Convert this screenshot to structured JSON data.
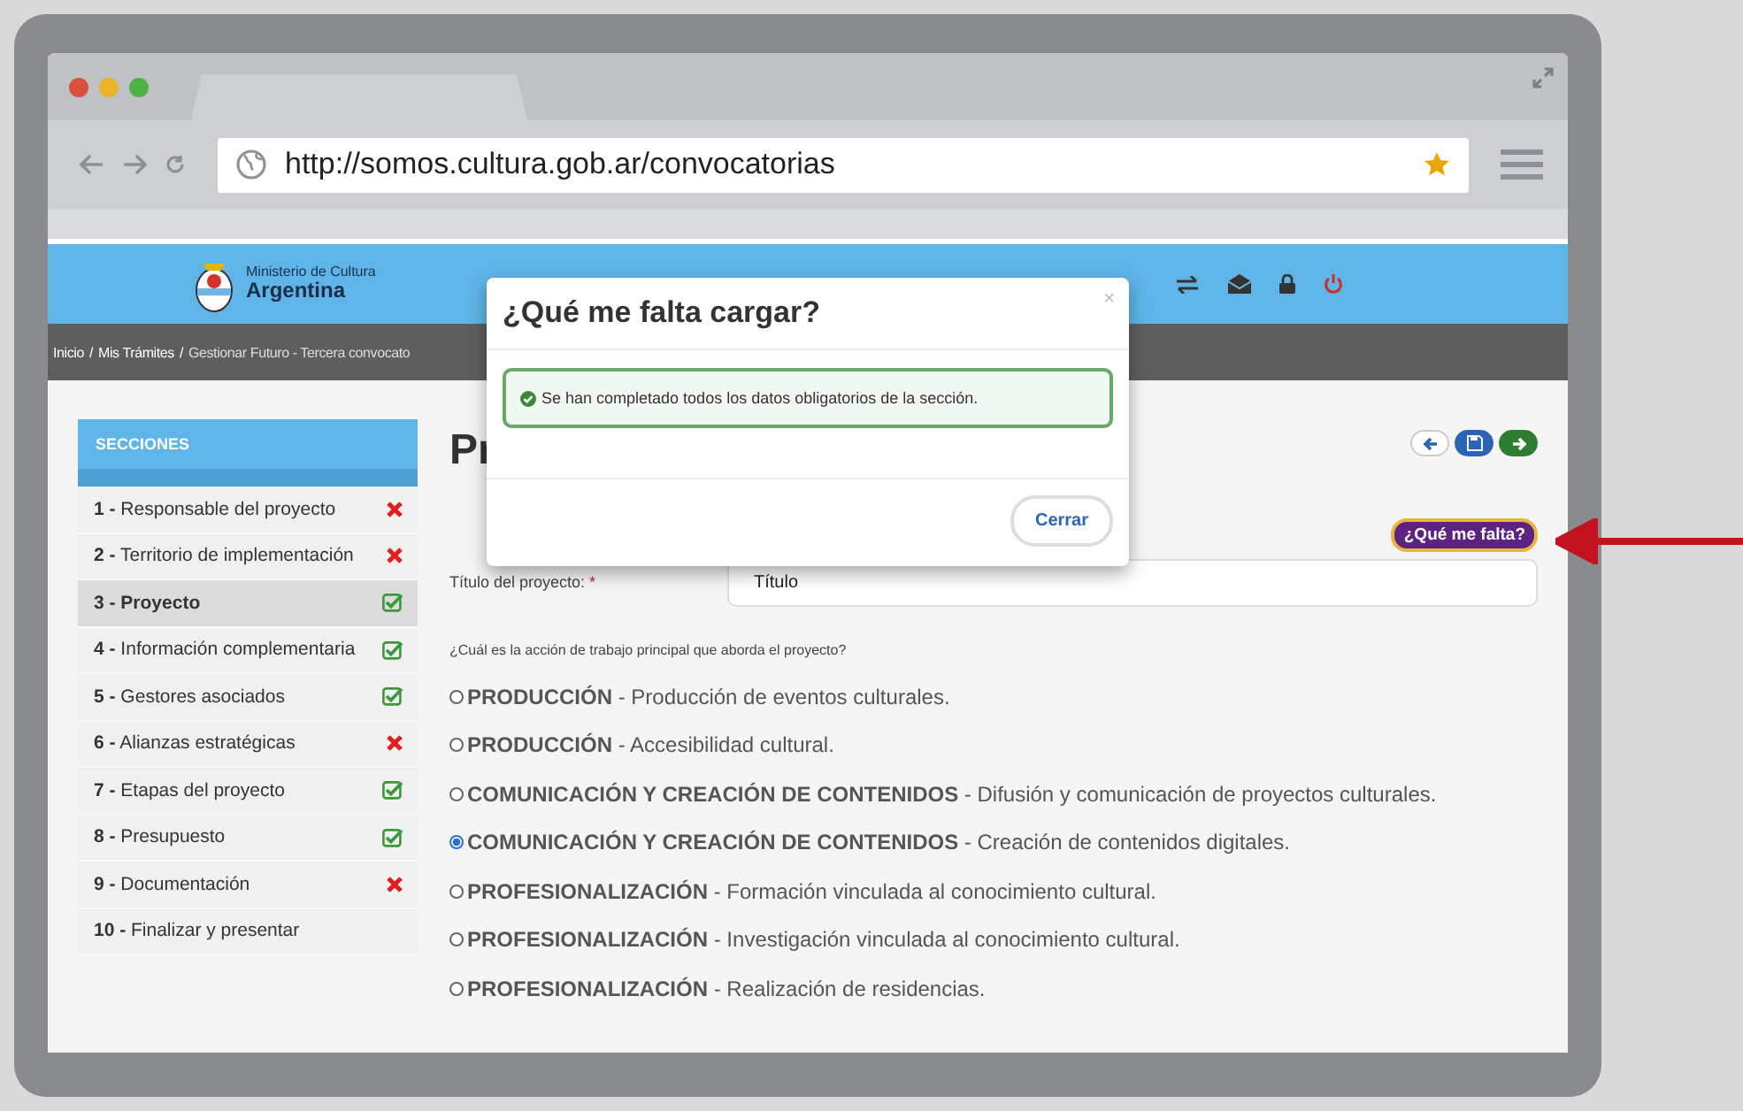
{
  "browser": {
    "url": "http://somos.cultura.gob.ar/convocatorias"
  },
  "header": {
    "ministry": "Ministerio de Cultura",
    "country": "Argentina"
  },
  "breadcrumb": [
    "Inicio",
    "/",
    "Mis Trámites",
    "/",
    "Gestionar Futuro - Tercera convocato"
  ],
  "sidebar": {
    "title": "SECCIONES",
    "items": [
      {
        "number": "1 -",
        "label": "Responsable del proyecto",
        "complete": false,
        "selected": false
      },
      {
        "number": "2 -",
        "label": "Territorio de implementación",
        "complete": false,
        "selected": false
      },
      {
        "number": "3 -",
        "label": "Proyecto",
        "complete": true,
        "selected": true
      },
      {
        "number": "4 -",
        "label": "Información complementaria",
        "complete": true,
        "selected": false
      },
      {
        "number": "5 -",
        "label": "Gestores asociados",
        "complete": true,
        "selected": false
      },
      {
        "number": "6 -",
        "label": "Alianzas estratégicas",
        "complete": false,
        "selected": false
      },
      {
        "number": "7 -",
        "label": "Etapas del proyecto",
        "complete": true,
        "selected": false
      },
      {
        "number": "8 -",
        "label": "Presupuesto",
        "complete": true,
        "selected": false
      },
      {
        "number": "9 -",
        "label": "Documentación",
        "complete": false,
        "selected": false
      },
      {
        "number": "10 -",
        "label": "Finalizar y presentar",
        "selected": false
      }
    ]
  },
  "page_title": "Pr",
  "help_button": "¿Qué me falta?",
  "form": {
    "title_label": "Título del proyecto:",
    "required_mark": "*",
    "title_value": "Título",
    "question": "¿Cuál es la acción de trabajo principal que aborda el proyecto?",
    "options": [
      {
        "category": "PRODUCCIÓN",
        "detail": "- Producción de eventos culturales.",
        "selected": false
      },
      {
        "category": "PRODUCCIÓN",
        "detail": "- Accesibilidad cultural.",
        "selected": false
      },
      {
        "category": "COMUNICACIÓN Y CREACIÓN DE CONTENIDOS",
        "detail": "- Difusión y comunicación de proyectos culturales.",
        "selected": false
      },
      {
        "category": "COMUNICACIÓN Y CREACIÓN DE CONTENIDOS",
        "detail": "- Creación de contenidos digitales.",
        "selected": true
      },
      {
        "category": "PROFESIONALIZACIÓN",
        "detail": "- Formación vinculada al conocimiento cultural.",
        "selected": false
      },
      {
        "category": "PROFESIONALIZACIÓN",
        "detail": "- Investigación vinculada al conocimiento cultural.",
        "selected": false
      },
      {
        "category": "PROFESIONALIZACIÓN",
        "detail": "- Realización de residencias.",
        "selected": false
      }
    ]
  },
  "modal": {
    "title": "¿Qué me falta cargar?",
    "close": "×",
    "message": "Se han completado todos los datos obligatorios de la sección.",
    "button": "Cerrar"
  }
}
